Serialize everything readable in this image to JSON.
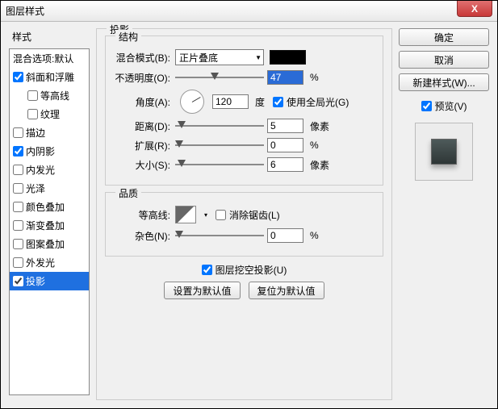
{
  "window": {
    "title": "图层样式"
  },
  "sidebar": {
    "title": "样式",
    "header": "混合选项:默认",
    "items": [
      {
        "label": "斜面和浮雕",
        "checked": true,
        "indent": false
      },
      {
        "label": "等高线",
        "checked": false,
        "indent": true
      },
      {
        "label": "纹理",
        "checked": false,
        "indent": true
      },
      {
        "label": "描边",
        "checked": false,
        "indent": false
      },
      {
        "label": "内阴影",
        "checked": true,
        "indent": false
      },
      {
        "label": "内发光",
        "checked": false,
        "indent": false
      },
      {
        "label": "光泽",
        "checked": false,
        "indent": false
      },
      {
        "label": "颜色叠加",
        "checked": false,
        "indent": false
      },
      {
        "label": "渐变叠加",
        "checked": false,
        "indent": false
      },
      {
        "label": "图案叠加",
        "checked": false,
        "indent": false
      },
      {
        "label": "外发光",
        "checked": false,
        "indent": false
      },
      {
        "label": "投影",
        "checked": true,
        "indent": false,
        "selected": true
      }
    ]
  },
  "panel": {
    "title": "投影",
    "structure": {
      "legend": "结构",
      "blendMode": {
        "label": "混合模式(B):",
        "value": "正片叠底",
        "color": "#000000"
      },
      "opacity": {
        "label": "不透明度(O):",
        "value": "47",
        "unit": "%",
        "pos": 40
      },
      "angle": {
        "label": "角度(A):",
        "value": "120",
        "unit": "度",
        "globalLabel": "使用全局光(G)",
        "globalChecked": true
      },
      "distance": {
        "label": "距离(D):",
        "value": "5",
        "unit": "像素",
        "pos": 3
      },
      "spread": {
        "label": "扩展(R):",
        "value": "0",
        "unit": "%",
        "pos": 0
      },
      "size": {
        "label": "大小(S):",
        "value": "6",
        "unit": "像素",
        "pos": 3
      }
    },
    "quality": {
      "legend": "品质",
      "contour": {
        "label": "等高线:",
        "antiAliasLabel": "消除锯齿(L)",
        "antiAliasChecked": false
      },
      "noise": {
        "label": "杂色(N):",
        "value": "0",
        "unit": "%",
        "pos": 0
      }
    },
    "knockout": {
      "label": "图层挖空投影(U)",
      "checked": true
    },
    "buttons": {
      "default": "设置为默认值",
      "reset": "复位为默认值"
    }
  },
  "right": {
    "ok": "确定",
    "cancel": "取消",
    "newStyle": "新建样式(W)...",
    "preview": {
      "label": "预览(V)",
      "checked": true
    }
  }
}
